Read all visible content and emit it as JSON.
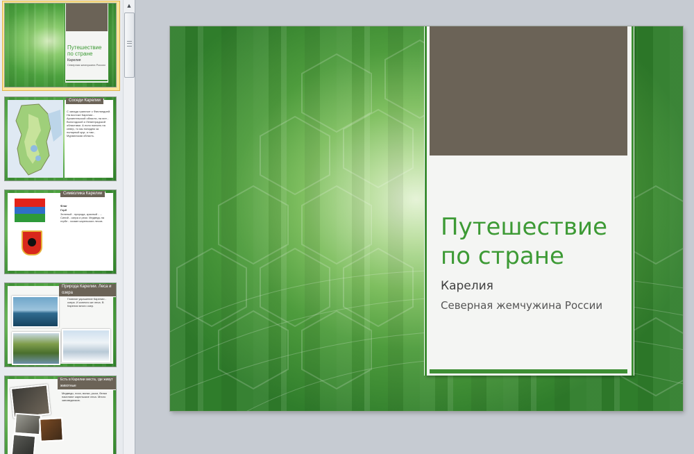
{
  "thumbnails": [
    {
      "title": "Путешествие по стране",
      "subtitle_1": "Карелия",
      "subtitle_2": "Северная жемчужина России"
    },
    {
      "header": "Соседи Карелии",
      "text": "С запада граничит с Финляндией. На востоке Карелии - Архангельской области, на юге - Вологодской и Ленинградской областями. А если поехать на север, то мы попадем за полярный круг, а там - Мурманская область."
    },
    {
      "header": "Символика Карелии",
      "text_heading": "Флаг",
      "text_sub": "Герб",
      "text": "Зеленый - природа, красный - ...  Синий - озера и реки. Медведь на гербе - хозяин карельских лесов."
    },
    {
      "header": "Природа Карелии. Леса и озера",
      "text": "Главное украшение Карелии - озера. И конечно же леса. В Карелии много озер."
    },
    {
      "header": "Есть в Карелии места, где живут животные",
      "text": "Медведи, лоси, волки, рыси, белки населяют карельские леса. Много заповедников."
    }
  ],
  "slide": {
    "title": "Путешествие по стране",
    "subtitle_1": "Карелия",
    "subtitle_2": "Северная жемчужина России"
  },
  "colors": {
    "accent_green": "#3d9a35",
    "placeholder_brown": "#6b6357",
    "selection": "#fbe59a"
  }
}
